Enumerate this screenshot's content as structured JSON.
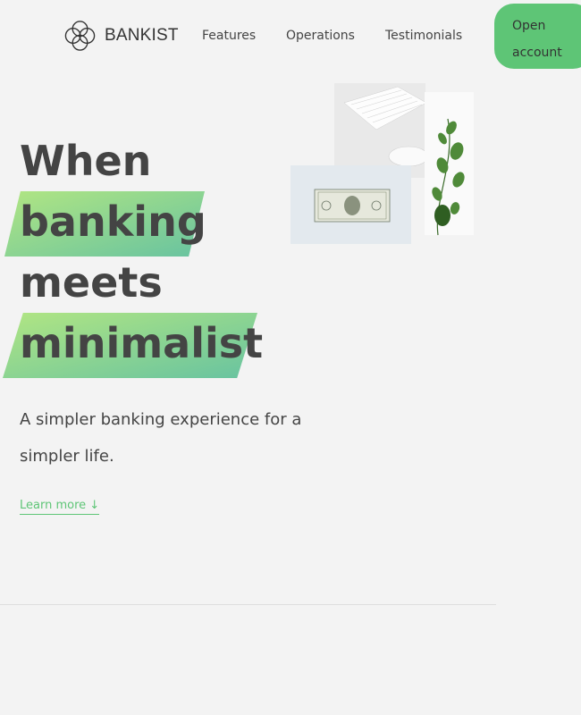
{
  "nav": {
    "brand": "BANKIST",
    "links": [
      "Features",
      "Operations",
      "Testimonials"
    ],
    "cta": "Open\naccount"
  },
  "hero": {
    "title_lines": [
      "When",
      "banking",
      "meets",
      "minimalist"
    ],
    "subtitle": "A simpler banking experience for a simpler life.",
    "learn_more": "Learn more ↓"
  },
  "colors": {
    "accent": "#5ec576",
    "highlight_start": "#9be15d",
    "highlight_end": "#39b385",
    "background": "#f3f3f3",
    "text": "#444444"
  },
  "icons": {
    "logo": "bankist-logo-icon"
  }
}
